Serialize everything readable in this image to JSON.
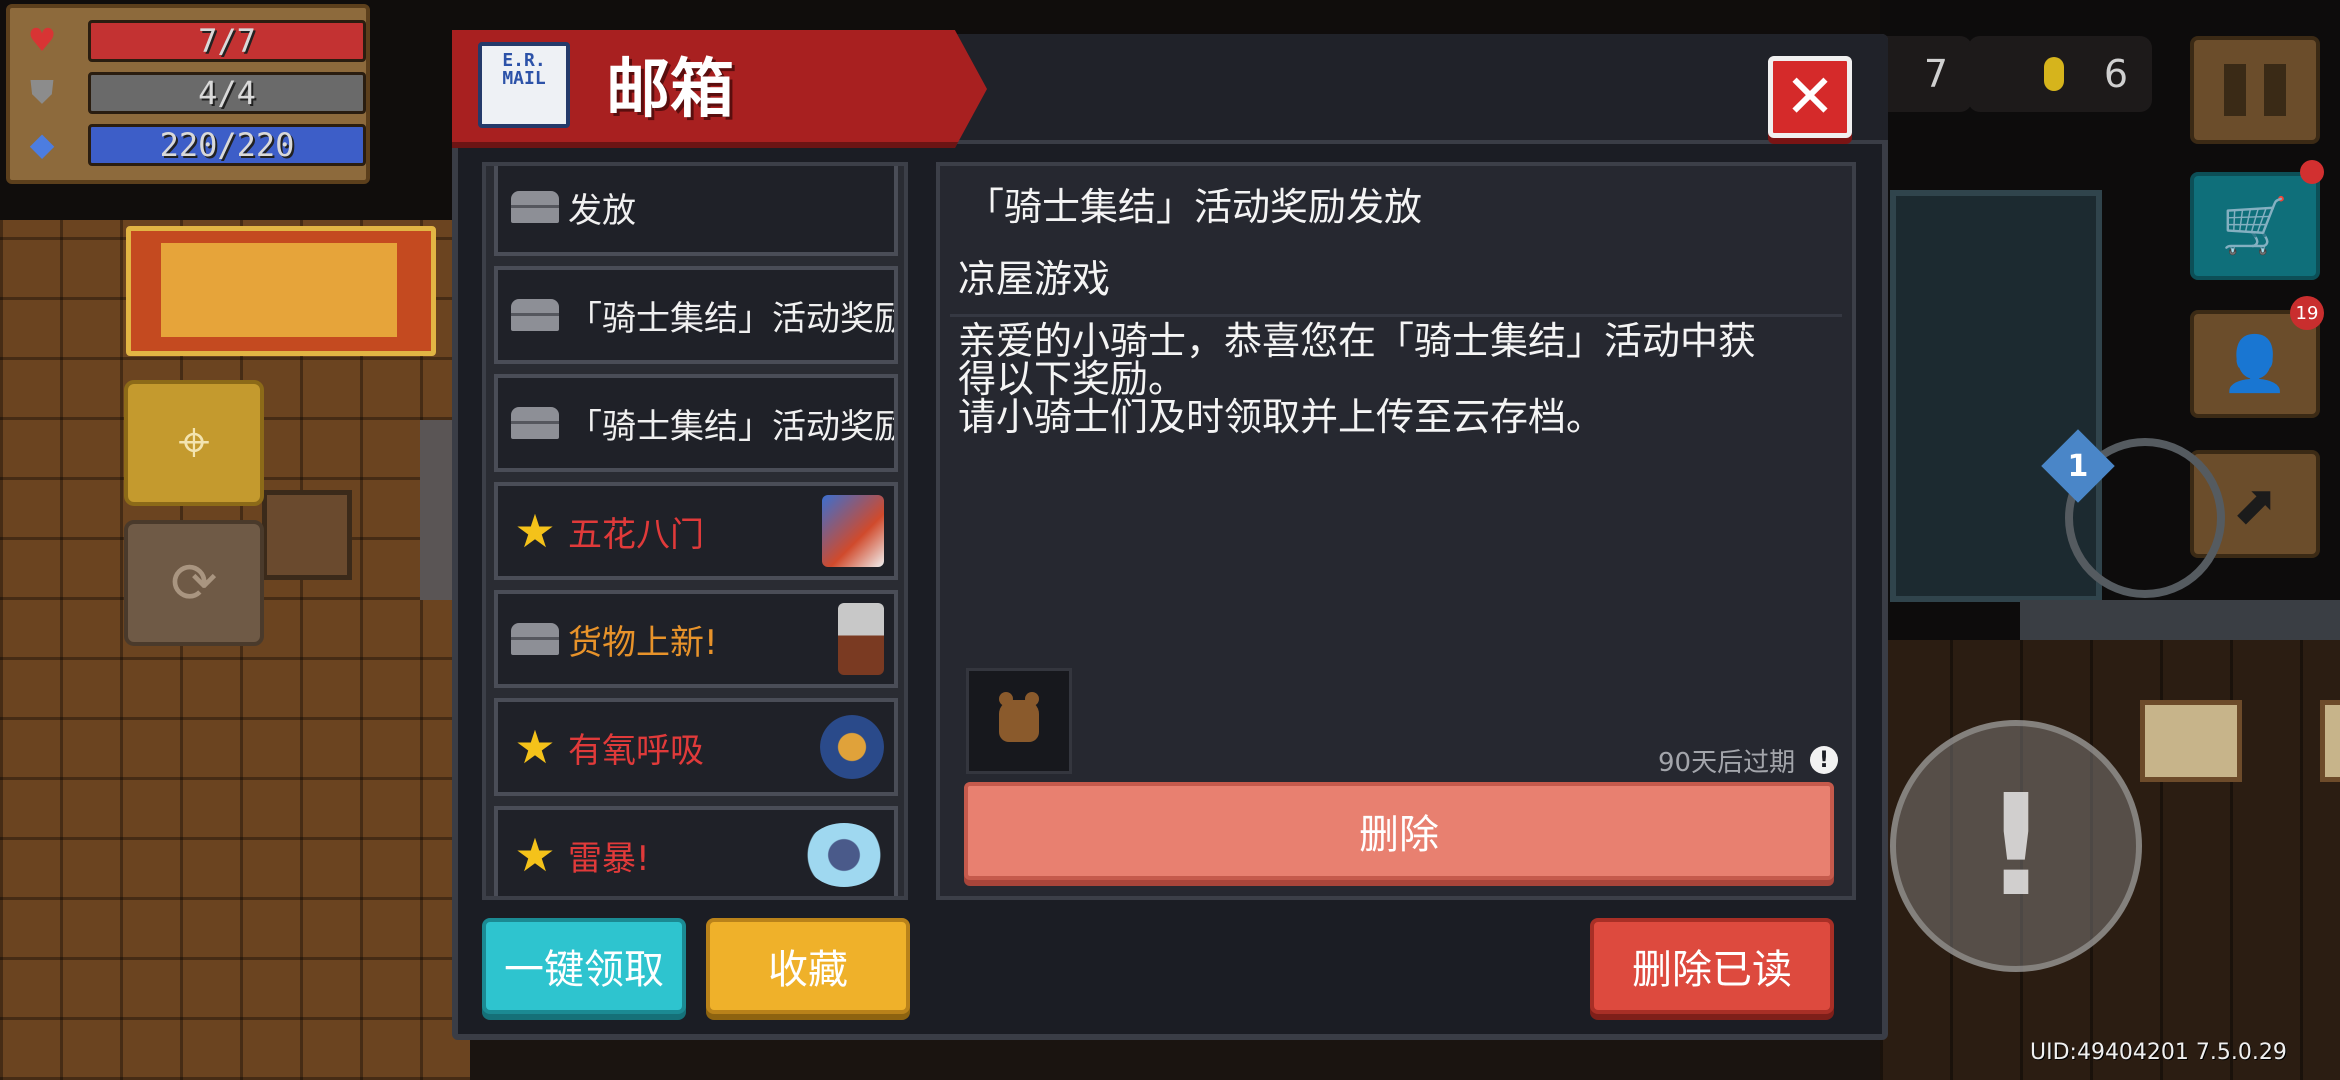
{
  "hud": {
    "hp": "7/7",
    "armor": "4/4",
    "energy": "220/220",
    "gem_count": "7",
    "coin_count": "6",
    "notification_count": "19",
    "level": "1"
  },
  "mailbox": {
    "title": "邮箱",
    "icon_text": "E.R.\nMAIL",
    "close_label": "✕",
    "mails": [
      {
        "label": "发放",
        "icon": "envelope-icon",
        "color": "white",
        "thumb": ""
      },
      {
        "label": "「骑士集结」活动奖励发放",
        "icon": "envelope-icon",
        "color": "white",
        "thumb": ""
      },
      {
        "label": "「骑士集结」活动奖励发放",
        "icon": "envelope-icon",
        "color": "white",
        "thumb": ""
      },
      {
        "label": "五花八门",
        "icon": "star-icon",
        "color": "red",
        "thumb": "bird-creature-icon"
      },
      {
        "label": "货物上新!",
        "icon": "envelope-icon",
        "color": "orange",
        "thumb": "merchant-icon"
      },
      {
        "label": "有氧呼吸",
        "icon": "star-icon",
        "color": "red",
        "thumb": "diver-icon"
      },
      {
        "label": "雷暴!",
        "icon": "star-icon",
        "color": "red",
        "thumb": "storm-icon"
      }
    ],
    "detail": {
      "title": "「骑士集结」活动奖励发放",
      "sender": "凉屋游戏",
      "body": "亲爱的小骑士，恭喜您在「骑士集结」活动中获\n得以下奖励。\n请小骑士们及时领取并上传至云存档。",
      "expire": "90天后过期",
      "delete_label": "删除"
    },
    "buttons": {
      "claim_all": "一键领取",
      "favorite": "收藏",
      "delete_read": "删除已读"
    }
  },
  "footer": {
    "uid": "UID:49404201 7.5.0.29"
  }
}
